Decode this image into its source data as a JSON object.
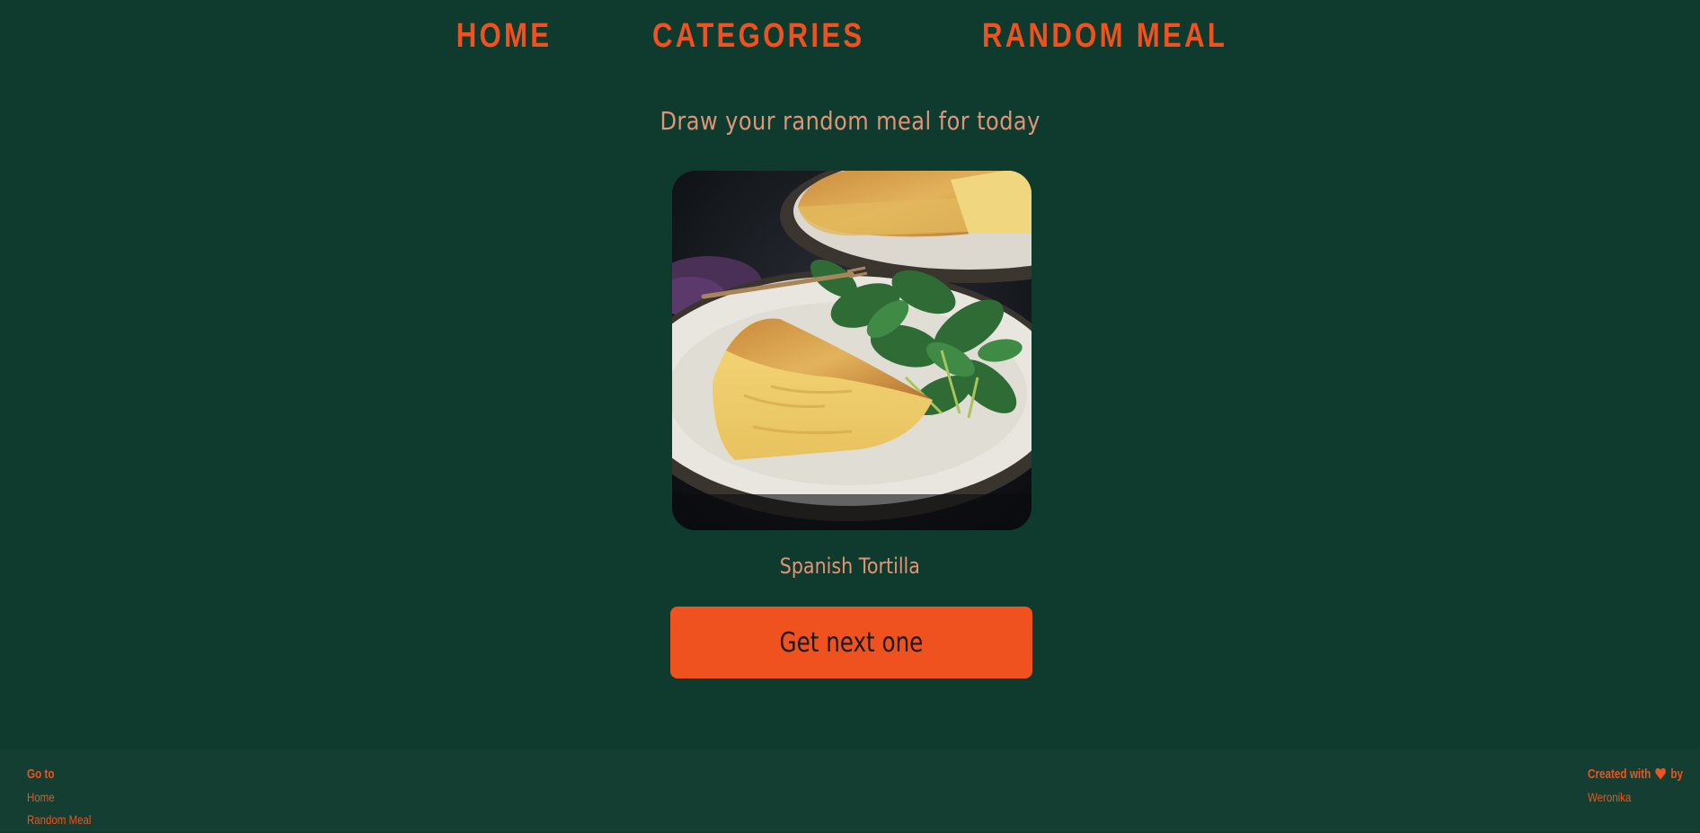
{
  "nav": {
    "items": [
      {
        "label": "HOME"
      },
      {
        "label": "CATEGORIES"
      },
      {
        "label": "RANDOM MEAL"
      }
    ]
  },
  "main": {
    "subtitle": "Draw your random meal for today",
    "meal": {
      "name": "Spanish Tortilla",
      "image_alt": "Spanish Tortilla"
    },
    "button_label": "Get next one"
  },
  "footer": {
    "goto_heading": "Go to",
    "links": [
      {
        "label": "Home"
      },
      {
        "label": "Random Meal"
      }
    ],
    "credit_prefix": "Created with",
    "credit_suffix": "by",
    "credit_icon": "heart-icon",
    "author": "Weronika"
  },
  "colors": {
    "background": "#0f3a2e",
    "footer_background": "#143e32",
    "accent": "#ef521e",
    "muted_text": "#e39477"
  }
}
